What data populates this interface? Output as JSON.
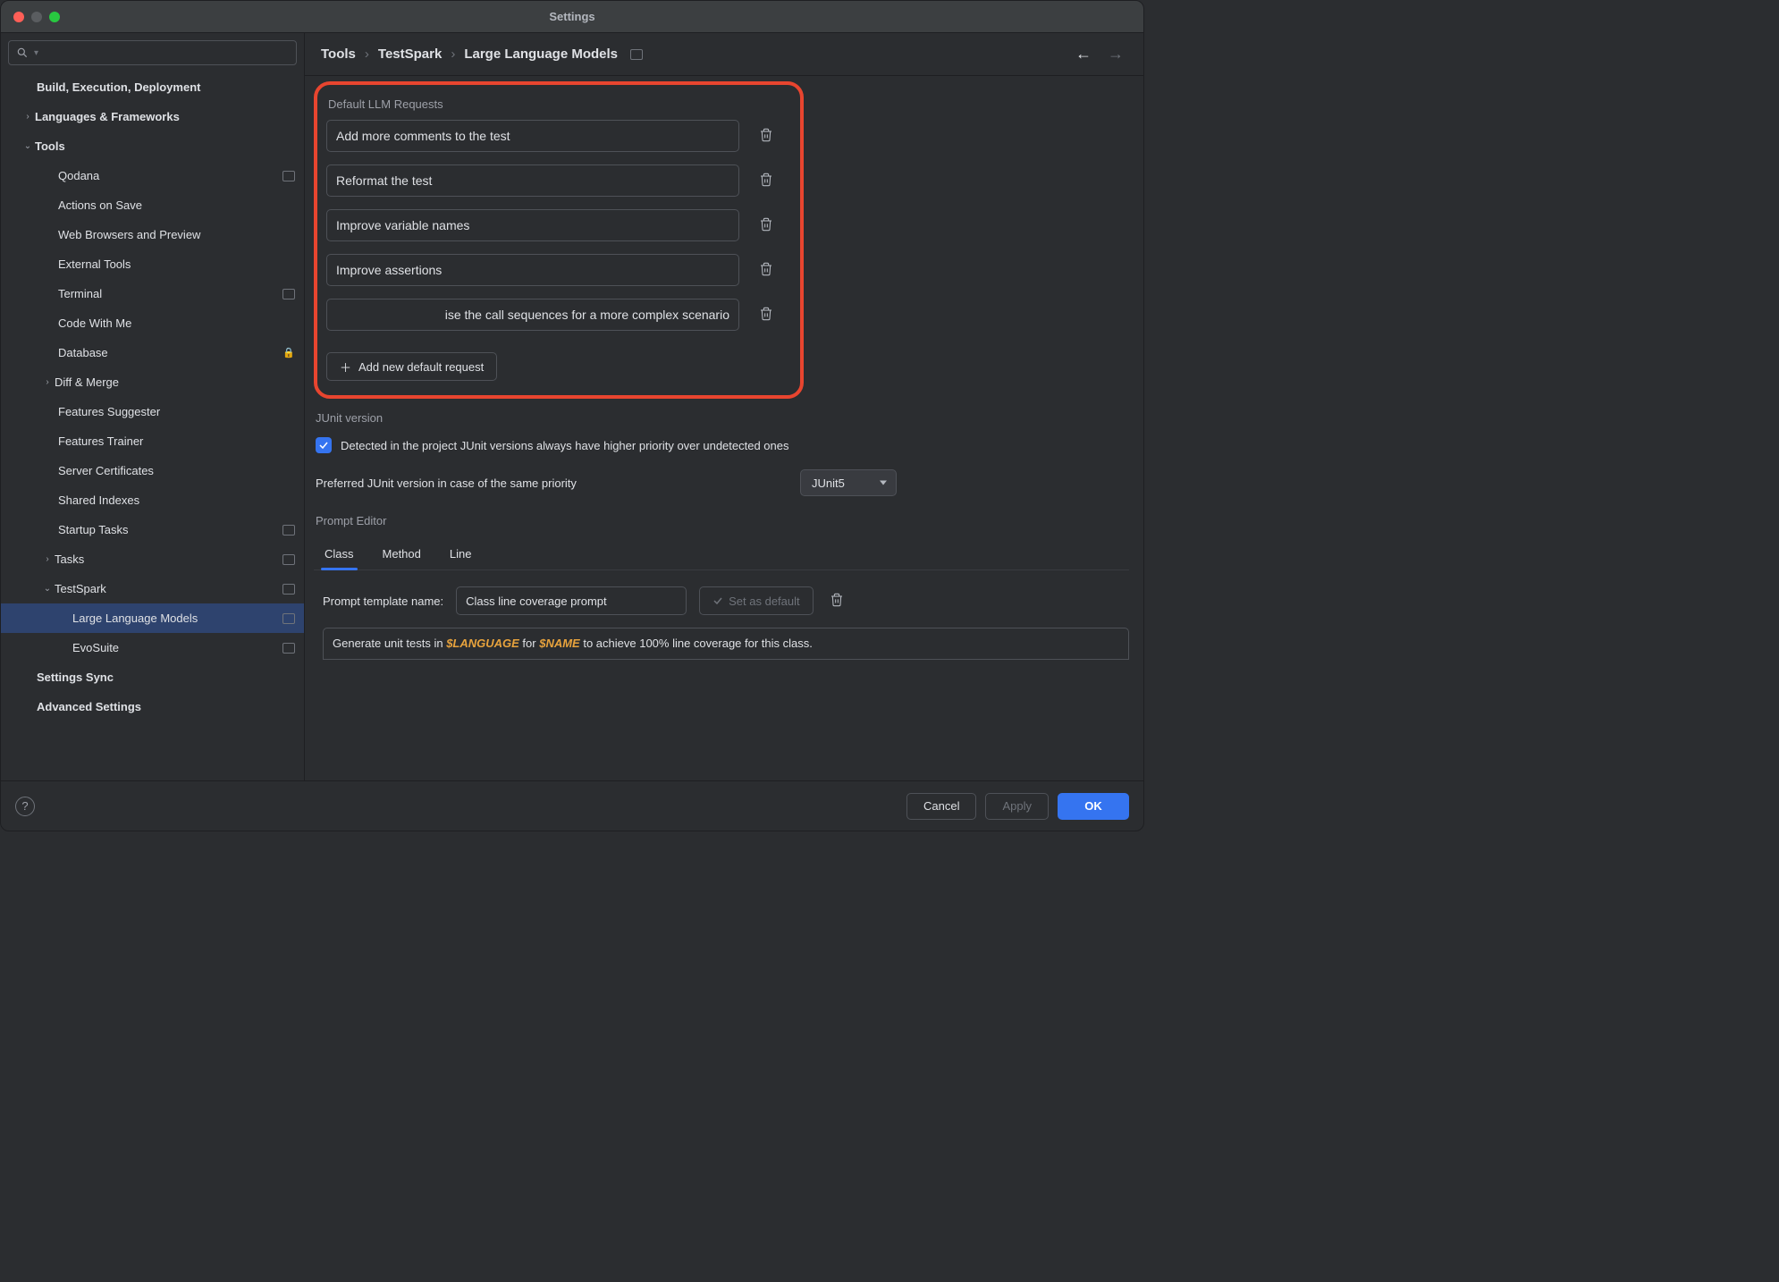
{
  "window": {
    "title": "Settings"
  },
  "breadcrumb": [
    "Tools",
    "TestSpark",
    "Large Language Models"
  ],
  "sidebar": {
    "search_placeholder": "",
    "items": [
      {
        "label": "Build, Execution, Deployment",
        "bold": true,
        "indent": 0
      },
      {
        "label": "Languages & Frameworks",
        "bold": true,
        "indent": 0,
        "expander": "›"
      },
      {
        "label": "Tools",
        "bold": true,
        "indent": 0,
        "expander": "⌄"
      },
      {
        "label": "Qodana",
        "indent": 2,
        "badge": true
      },
      {
        "label": "Actions on Save",
        "indent": 2
      },
      {
        "label": "Web Browsers and Preview",
        "indent": 2
      },
      {
        "label": "External Tools",
        "indent": 2
      },
      {
        "label": "Terminal",
        "indent": 2,
        "badge": true
      },
      {
        "label": "Code With Me",
        "indent": 2
      },
      {
        "label": "Database",
        "indent": 2,
        "lock": true
      },
      {
        "label": "Diff & Merge",
        "indent": 1,
        "expander": "›",
        "exp_indent": 2
      },
      {
        "label": "Features Suggester",
        "indent": 2
      },
      {
        "label": "Features Trainer",
        "indent": 2
      },
      {
        "label": "Server Certificates",
        "indent": 2
      },
      {
        "label": "Shared Indexes",
        "indent": 2
      },
      {
        "label": "Startup Tasks",
        "indent": 2,
        "badge": true
      },
      {
        "label": "Tasks",
        "indent": 1,
        "expander": "›",
        "exp_indent": 2,
        "badge": true
      },
      {
        "label": "TestSpark",
        "indent": 1,
        "expander": "⌄",
        "exp_indent": 2,
        "badge": true
      },
      {
        "label": "Large Language Models",
        "indent": 3,
        "badge": true,
        "selected": true
      },
      {
        "label": "EvoSuite",
        "indent": 3,
        "badge": true
      },
      {
        "label": "Settings Sync",
        "bold": true,
        "indent": 0
      },
      {
        "label": "Advanced Settings",
        "bold": true,
        "indent": 0
      }
    ]
  },
  "llm_requests": {
    "title": "Default LLM Requests",
    "items": [
      "Add more comments to the test",
      "Reformat the test",
      "Improve variable names",
      "Improve assertions",
      "ise the call sequences for a more complex scenario"
    ],
    "add_label": "Add new default request"
  },
  "junit": {
    "title": "JUnit version",
    "checkbox_label": "Detected in the project JUnit versions always have higher priority over undetected ones",
    "preferred_label": "Preferred JUnit version in case of the same priority",
    "preferred_value": "JUnit5"
  },
  "prompt_editor": {
    "title": "Prompt Editor",
    "tabs": [
      "Class",
      "Method",
      "Line"
    ],
    "active_tab": "Class",
    "name_label": "Prompt template name:",
    "name_value": "Class line coverage prompt",
    "set_default_label": "Set as default",
    "template_prefix": "Generate unit tests in ",
    "var1": "$LANGUAGE",
    "mid": " for ",
    "var2": "$NAME",
    "suffix": " to achieve 100% line coverage for this class."
  },
  "footer": {
    "cancel": "Cancel",
    "apply": "Apply",
    "ok": "OK"
  }
}
